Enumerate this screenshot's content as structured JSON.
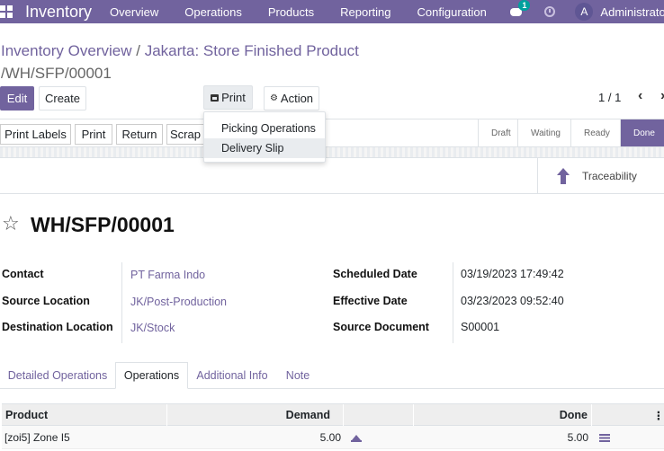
{
  "navbar": {
    "brand": "Inventory",
    "menu": [
      "Overview",
      "Operations",
      "Products",
      "Reporting",
      "Configuration"
    ],
    "chat_badge": "1",
    "avatar_initial": "A",
    "username": "Administrator"
  },
  "breadcrumb": {
    "parent1": "Inventory Overview",
    "parent2": "Jakarta: Store Finished Product",
    "separator": "/",
    "current": "WH/SFP/00001"
  },
  "controls": {
    "edit": "Edit",
    "create": "Create",
    "print": "Print",
    "action": "Action",
    "pager": "1 / 1"
  },
  "print_menu": {
    "items": [
      "Picking Operations",
      "Delivery Slip"
    ]
  },
  "statusbar": {
    "buttons": [
      "Print Labels",
      "Print",
      "Return",
      "Scrap"
    ],
    "stages": [
      "Draft",
      "Waiting",
      "Ready",
      "Done"
    ],
    "current_stage": "Done"
  },
  "smart_buttons": {
    "traceability": "Traceability"
  },
  "record": {
    "title": "WH/SFP/00001",
    "fields_left": [
      {
        "label": "Contact",
        "value": "PT Farma Indo"
      },
      {
        "label": "Source Location",
        "value": "JK/Post-Production"
      },
      {
        "label": "Destination Location",
        "value": "JK/Stock"
      }
    ],
    "fields_right": [
      {
        "label": "Scheduled Date",
        "value": "03/19/2023 17:49:42"
      },
      {
        "label": "Effective Date",
        "value": "03/23/2023 09:52:40"
      },
      {
        "label": "Source Document",
        "value": "S00001"
      }
    ]
  },
  "tabs": [
    "Detailed Operations",
    "Operations",
    "Additional Info",
    "Note"
  ],
  "active_tab": "Operations",
  "table": {
    "columns": [
      "Product",
      "Demand",
      "Done"
    ],
    "rows": [
      {
        "product": "[zoi5] Zone I5",
        "demand": "5.00",
        "done": "5.00"
      }
    ]
  },
  "colors": {
    "brand": "#71639e",
    "badge": "#00a09d"
  }
}
